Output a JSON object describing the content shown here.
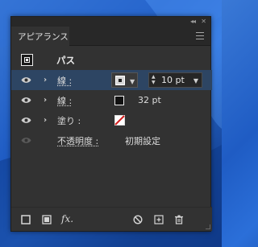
{
  "panel": {
    "tab_label": "アピアランス",
    "collapse_icon": "double-chevron-left",
    "close_icon": "close"
  },
  "path_row": {
    "label": "パス"
  },
  "rows": [
    {
      "label": "線 :",
      "swatch": "white-fill-box",
      "selected": true,
      "stroke_weight": "10 pt"
    },
    {
      "label": "線 :",
      "swatch": "black-outline-box",
      "value": "32 pt"
    },
    {
      "label": "塗り :",
      "swatch": "none-red-slash"
    },
    {
      "label": "不透明度 :",
      "value": "初期設定"
    }
  ],
  "footer_icons": [
    "add-new-stroke",
    "add-new-fill",
    "fx",
    "clear-appearance",
    "duplicate-item",
    "delete-item"
  ],
  "colors": {
    "panel_bg": "#323232",
    "selected_row": "#2d4563",
    "none_slash": "#d21e1e"
  }
}
